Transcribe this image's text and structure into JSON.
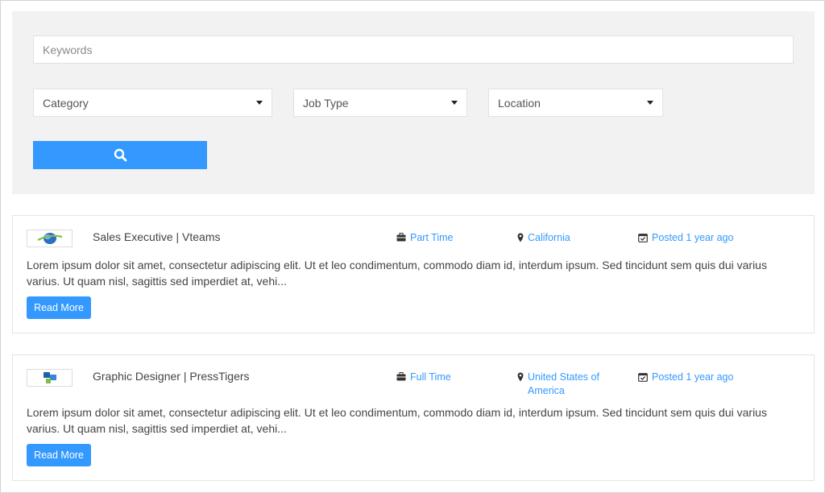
{
  "search": {
    "keywords_placeholder": "Keywords",
    "category_label": "Category",
    "job_type_label": "Job Type",
    "location_label": "Location",
    "button_icon": "search-icon"
  },
  "jobs": [
    {
      "title": "Sales Executive | Vteams",
      "job_type": "Part Time",
      "location": "California",
      "posted": "Posted 1 year ago",
      "description": "Lorem ipsum dolor sit amet, consectetur adipiscing elit. Ut et leo condimentum, commodo diam id, interdum ipsum. Sed tincidunt sem quis dui varius varius. Ut quam nisl, sagittis sed imperdiet at, vehi...",
      "read_more": "Read More"
    },
    {
      "title": "Graphic Designer | PressTigers",
      "job_type": "Full Time",
      "location": "United States of America",
      "posted": "Posted 1 year ago",
      "description": "Lorem ipsum dolor sit amet, consectetur adipiscing elit. Ut et leo condimentum, commodo diam id, interdum ipsum. Sed tincidunt sem quis dui varius varius. Ut quam nisl, sagittis sed imperdiet at, vehi...",
      "read_more": "Read More"
    }
  ],
  "colors": {
    "accent": "#3399ff",
    "panel_bg": "#f2f2f2"
  }
}
